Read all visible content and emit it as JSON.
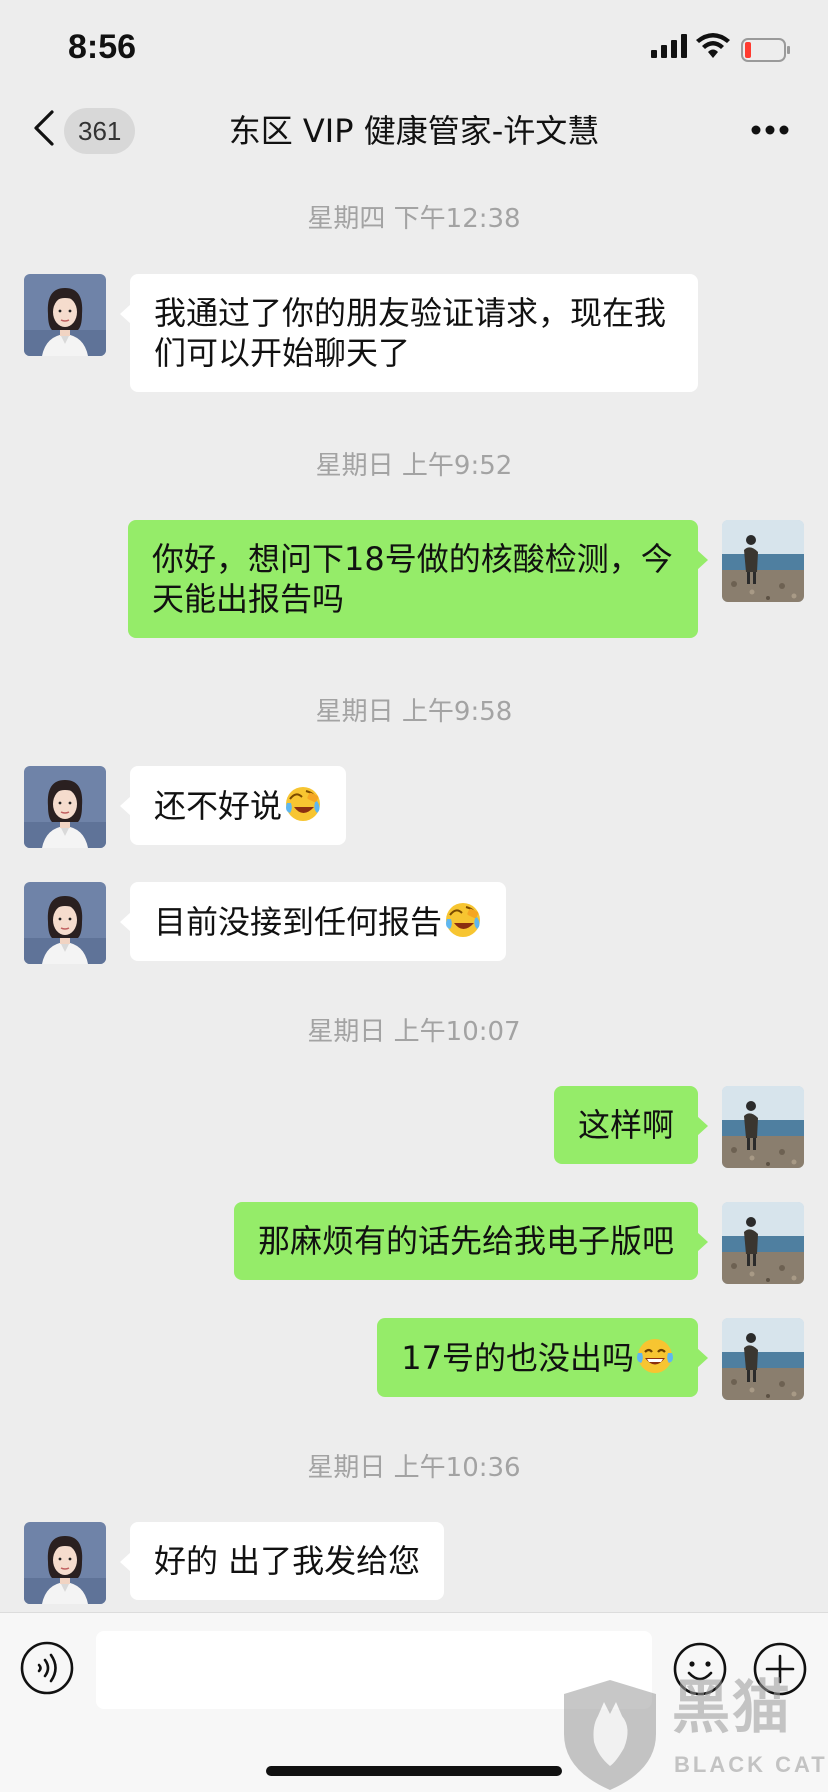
{
  "status_bar": {
    "time": "8:56",
    "icons": [
      "cellular-signal-icon",
      "wifi-icon",
      "battery-low-icon"
    ]
  },
  "nav": {
    "back_icon": "chevron-left-icon",
    "unread_count": "361",
    "title": "东区 VIP 健康管家-许文慧",
    "more_icon": "more-horizontal-icon"
  },
  "timestamps": [
    "星期四 下午12:38",
    "星期日 上午9:52",
    "星期日 上午9:58",
    "星期日 上午10:07",
    "星期日 上午10:36"
  ],
  "messages": [
    {
      "sender": "contact",
      "text": "我通过了你的朋友验证请求，现在我们可以开始聊天了"
    },
    {
      "sender": "me",
      "text": "你好，想问下18号做的核酸检测，今天能出报告吗"
    },
    {
      "sender": "contact",
      "text": "还不好说",
      "emoji": "crying-laughing-face"
    },
    {
      "sender": "contact",
      "text": "目前没接到任何报告",
      "emoji": "crying-laughing-face"
    },
    {
      "sender": "me",
      "text": "这样啊"
    },
    {
      "sender": "me",
      "text": "那麻烦有的话先给我电子版吧"
    },
    {
      "sender": "me",
      "text": "17号的也没出吗",
      "emoji": "tears-of-joy-face"
    },
    {
      "sender": "contact",
      "text": "好的 出了我发给您"
    }
  ],
  "input_bar": {
    "voice_icon": "voice-input-icon",
    "emoji_icon": "emoji-face-icon",
    "plus_icon": "plus-circle-icon",
    "draft": ""
  },
  "watermark": {
    "cn": "黑猫",
    "en": "BLACK CAT"
  },
  "colors": {
    "background": "#ededed",
    "sent_bubble": "#95ec69",
    "received_bubble": "#ffffff",
    "timestamp_text": "#a3a3a3"
  }
}
